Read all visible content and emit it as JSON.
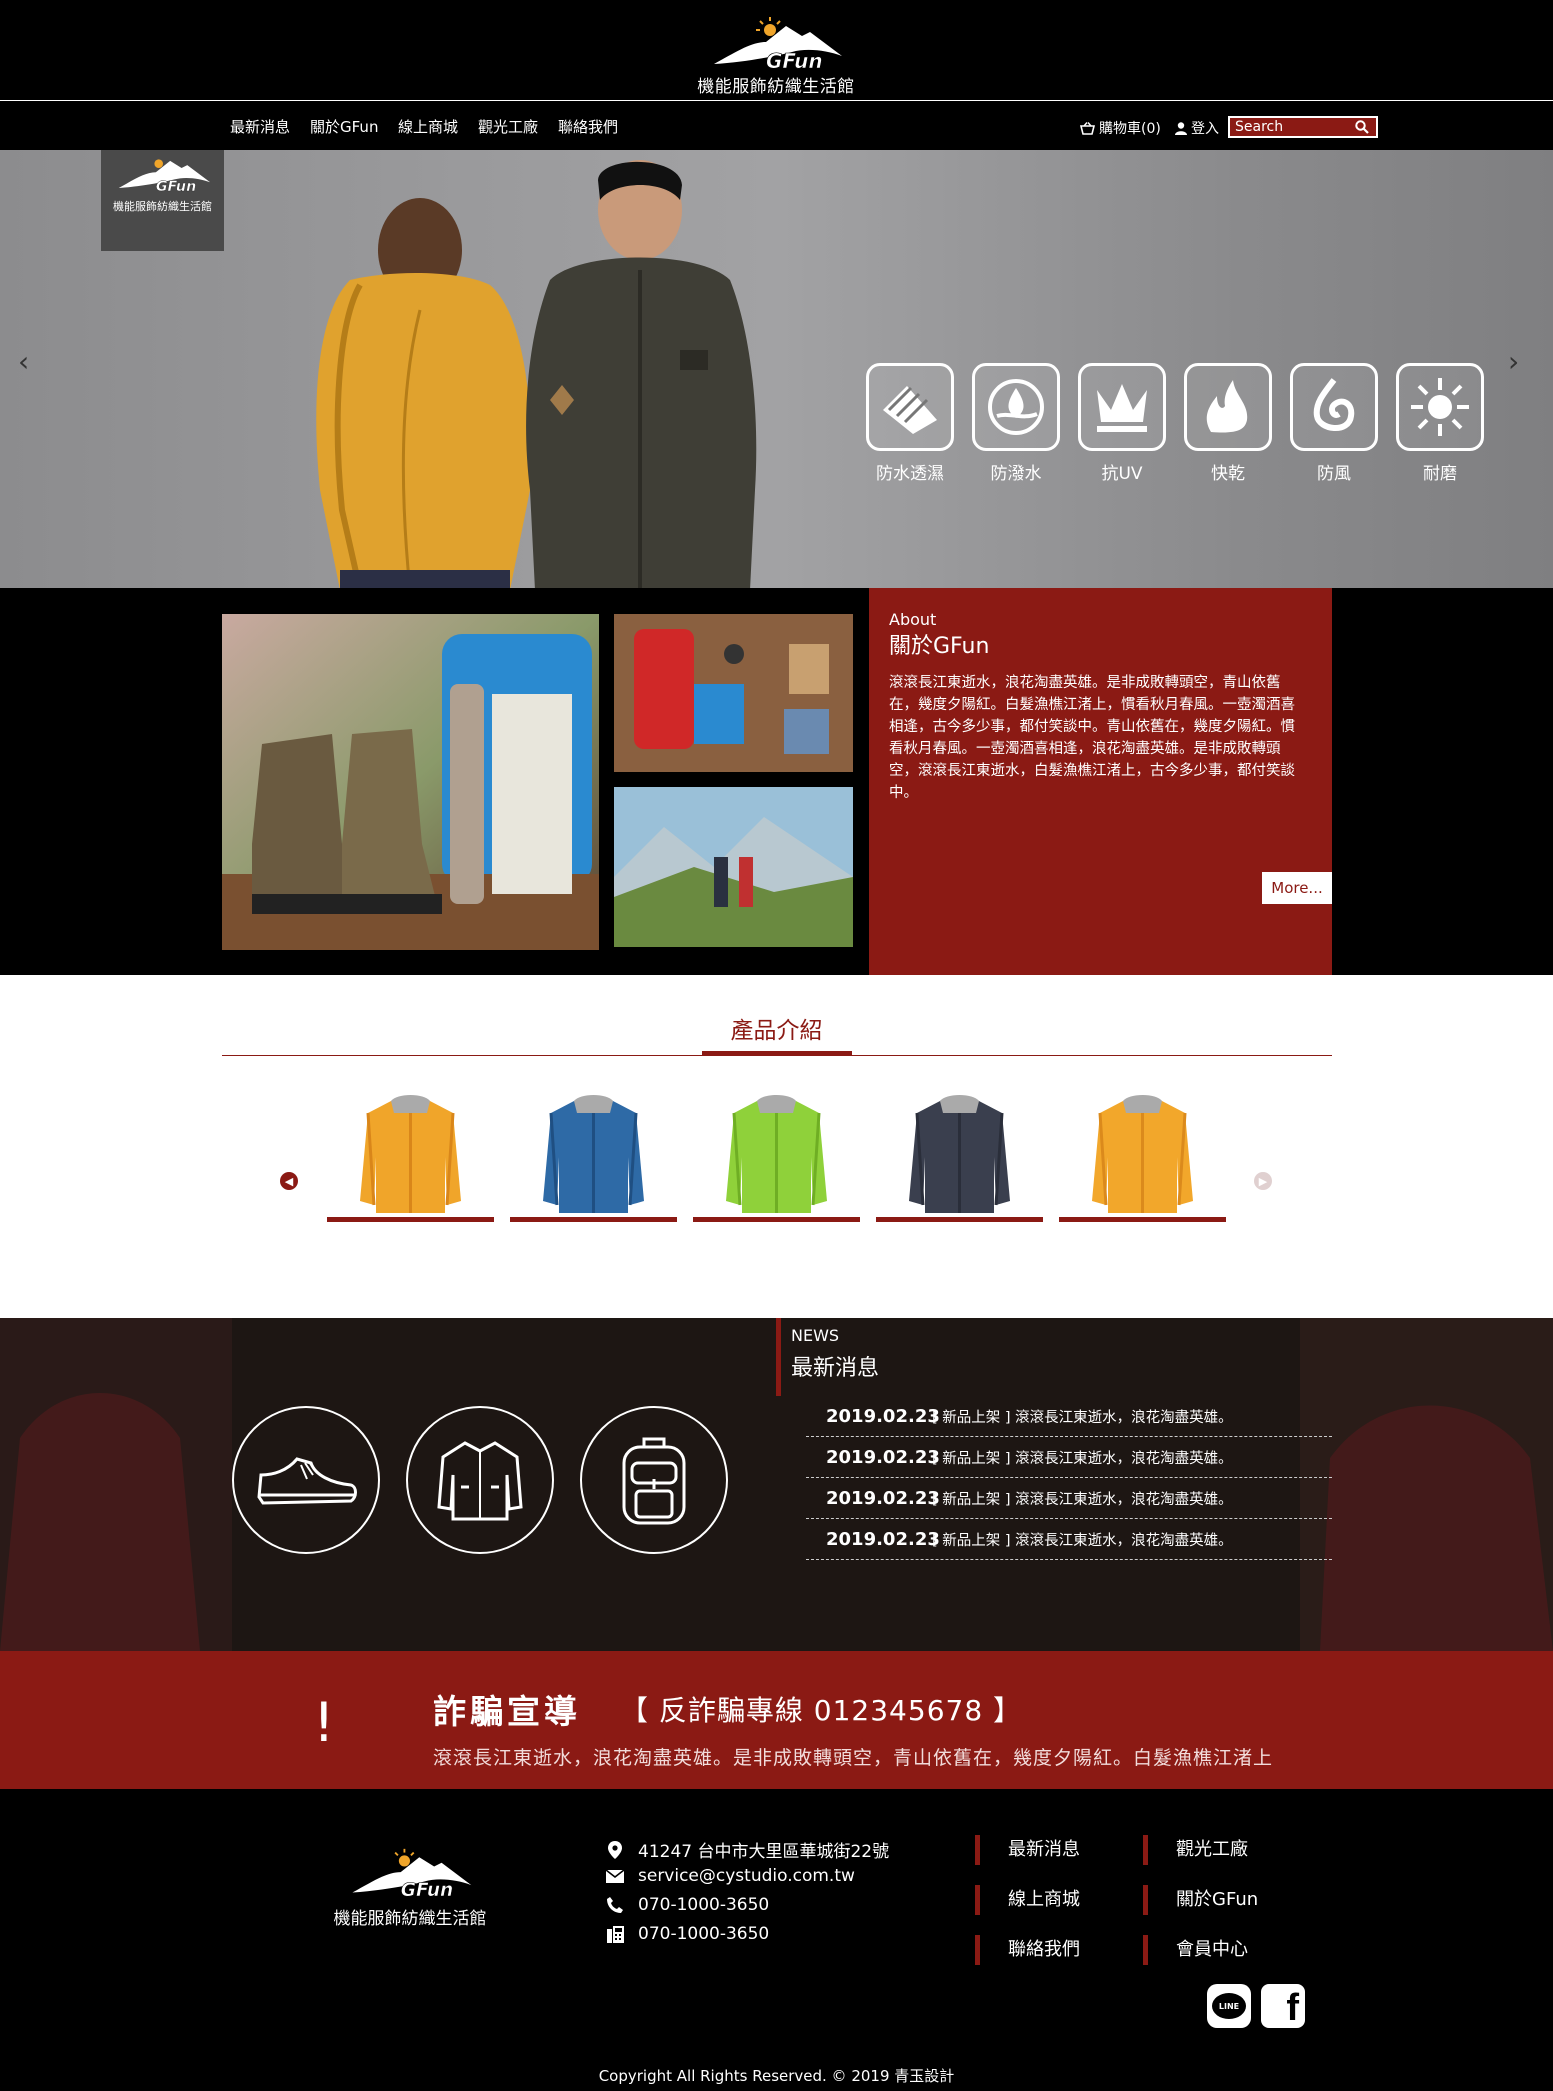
{
  "header": {
    "brand": "GFun",
    "tagline": "機能服飾紡織生活館"
  },
  "nav": {
    "items": [
      "最新消息",
      "關於GFun",
      "線上商城",
      "觀光工廠",
      "聯絡我們"
    ],
    "cart_label": "購物車(0)",
    "login_label": "登入",
    "search_placeholder": "Search"
  },
  "hero": {
    "badge_brand": "GFun",
    "badge_tagline": "機能服飾紡織生活館",
    "prev_arrow": "‹",
    "next_arrow": "›",
    "features": [
      {
        "label": "防水透濕",
        "icon": "layers-icon"
      },
      {
        "label": "防潑水",
        "icon": "water-drop-icon"
      },
      {
        "label": "抗UV",
        "icon": "uv-shield-icon"
      },
      {
        "label": "快乾",
        "icon": "flame-icon"
      },
      {
        "label": "防風",
        "icon": "wind-swirl-icon"
      },
      {
        "label": "耐磨",
        "icon": "sun-burst-icon"
      }
    ]
  },
  "about": {
    "eyebrow": "About",
    "title": "關於GFun",
    "body": "滾滾長江東逝水，浪花淘盡英雄。是非成敗轉頭空，青山依舊在，幾度夕陽紅。白髮漁樵江渚上，慣看秋月春風。一壺濁酒喜相逢，古今多少事，都付笑談中。青山依舊在，幾度夕陽紅。慣看秋月春風。一壺濁酒喜相逢，浪花淘盡英雄。是非成敗轉頭空，滾滾長江東逝水，白髮漁樵江渚上，古今多少事，都付笑談中。",
    "more_label": "More..."
  },
  "products": {
    "title": "產品介紹",
    "items": [
      {
        "color": "#f0a52a",
        "shade": "#d9861a",
        "name": "orange-jacket"
      },
      {
        "color": "#2e6aa6",
        "shade": "#1f4f82",
        "name": "blue-jacket"
      },
      {
        "color": "#8fd13a",
        "shade": "#6fae24",
        "name": "green-jacket"
      },
      {
        "color": "#3a3f4e",
        "shade": "#2a2e3a",
        "name": "navy-jacket"
      },
      {
        "color": "#f2a72b",
        "shade": "#db8a1c",
        "name": "orange-jacket-2"
      }
    ]
  },
  "news": {
    "eyebrow": "NEWS",
    "title": "最新消息",
    "items": [
      {
        "date": "2019.02.23",
        "text": "[ 新品上架 ] 滾滾長江東逝水，浪花淘盡英雄。"
      },
      {
        "date": "2019.02.23",
        "text": "[ 新品上架 ] 滾滾長江東逝水，浪花淘盡英雄。"
      },
      {
        "date": "2019.02.23",
        "text": "[ 新品上架 ] 滾滾長江東逝水，浪花淘盡英雄。"
      },
      {
        "date": "2019.02.23",
        "text": "[ 新品上架 ] 滾滾長江東逝水，浪花淘盡英雄。"
      }
    ]
  },
  "alert": {
    "mark": "!",
    "title": "詐騙宣導",
    "hotline": "【 反詐騙專線 012345678 】",
    "text": "滾滾長江東逝水，浪花淘盡英雄。是非成敗轉頭空，青山依舊在，幾度夕陽紅。白髮漁樵江渚上"
  },
  "footer": {
    "brand": "GFun",
    "tagline": "機能服飾紡織生活館",
    "address": "41247 台中市大里區華城街22號",
    "email": "service@cystudio.com.tw",
    "phone": "070-1000-3650",
    "fax": "070-1000-3650",
    "links": [
      "最新消息",
      "觀光工廠",
      "線上商城",
      "關於GFun",
      "聯絡我們",
      "會員中心"
    ],
    "social_line": "LINE",
    "social_fb": "f",
    "copyright": "Copyright All Rights Reserved. © 2019 青玉設計"
  },
  "colors": {
    "accent": "#8b1a14",
    "background": "#000000"
  }
}
